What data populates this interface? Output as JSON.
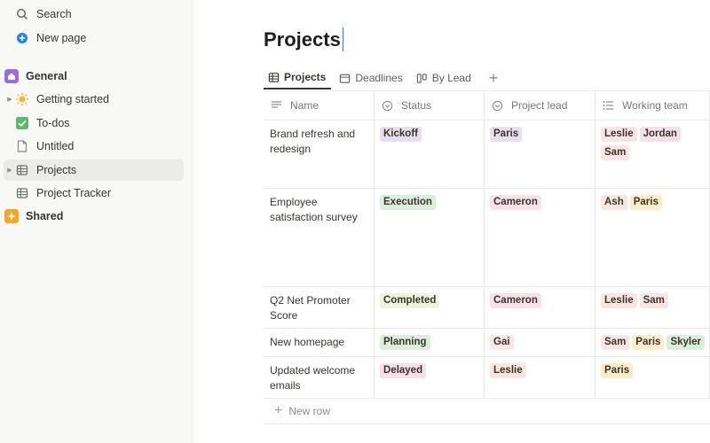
{
  "sidebar": {
    "search": "Search",
    "new_page": "New page",
    "general": "General",
    "items": [
      {
        "label": "Getting started"
      },
      {
        "label": "To-dos"
      },
      {
        "label": "Untitled"
      },
      {
        "label": "Projects"
      },
      {
        "label": "Project Tracker"
      }
    ],
    "shared": "Shared"
  },
  "page": {
    "title": "Projects"
  },
  "tabs": [
    {
      "label": "Projects"
    },
    {
      "label": "Deadlines"
    },
    {
      "label": "By Lead"
    }
  ],
  "table": {
    "headers": [
      "Name",
      "Status",
      "Project lead",
      "Working team"
    ],
    "rows": [
      {
        "name": "Brand refresh and redesign",
        "status": "Kickoff",
        "lead": "Paris",
        "team": [
          "Leslie",
          "Jordan",
          "Sam"
        ]
      },
      {
        "name": "Employee satisfaction survey",
        "status": "Execution",
        "lead": "Cameron",
        "team": [
          "Ash",
          "Paris"
        ]
      },
      {
        "name": "Q2 Net Promoter Score",
        "status": "Completed",
        "lead": "Cameron",
        "team": [
          "Leslie",
          "Sam"
        ]
      },
      {
        "name": "New homepage",
        "status": "Planning",
        "lead": "Gai",
        "team": [
          "Sam",
          "Paris",
          "Skyler"
        ]
      },
      {
        "name": "Updated welcome emails",
        "status": "Delayed",
        "lead": "Leslie",
        "team": [
          "Paris"
        ]
      }
    ],
    "new_row": "New row"
  },
  "colors": {
    "kickoff": "#e8deee",
    "execution": "#dbeddb",
    "completed": "#eef3da",
    "planning": "#dbeddb",
    "delayed": "#f5e0e9",
    "paris": "#fdecc8",
    "cameron": "#f9e1ea",
    "gai": "#fce6e6",
    "leslie": "#fbe4e4",
    "jordan": "#f5e0e9",
    "sam": "#fbe4e4",
    "ash": "#fbe6dd",
    "skyler": "#dbeddb",
    "lead_paris": "#e8deee",
    "lead_leslie": "#fbe6dd"
  }
}
